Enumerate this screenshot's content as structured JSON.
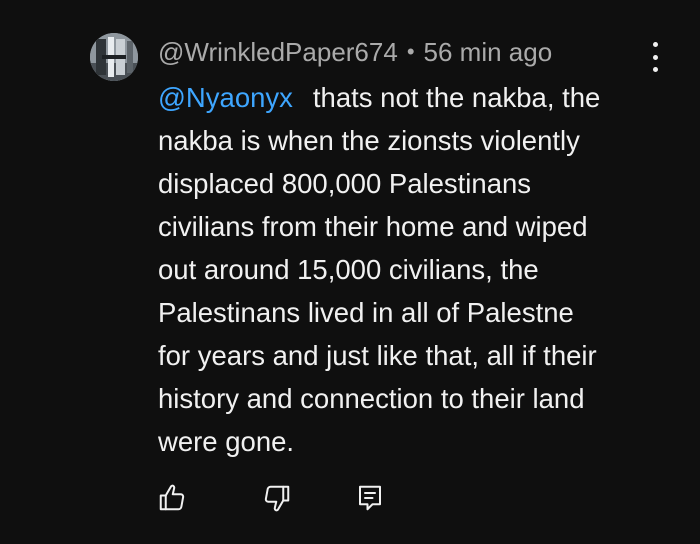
{
  "comment": {
    "author": "@WrinkledPaper674",
    "separator": "•",
    "timestamp": "56 min ago",
    "mention": "@Nyaonyx",
    "lines": [
      "thats not the nakba, the",
      "nakba is when the zionsts violently",
      "displaced 800,000 Palestinans",
      "civilians from their home and wiped",
      "out around 15,000 civilians, the",
      "Palestinans lived in all of Palestne",
      "for years and just like that, all if their",
      "history and connection to their land",
      "were gone."
    ]
  },
  "icons": {
    "more": "kebab-menu-icon",
    "like": "thumbs-up-icon",
    "dislike": "thumbs-down-icon",
    "reply": "reply-comment-icon"
  },
  "colors": {
    "background": "#0f0f0f",
    "text": "#f1f1f1",
    "meta": "#aaaaaa",
    "mention": "#3ea6ff"
  }
}
